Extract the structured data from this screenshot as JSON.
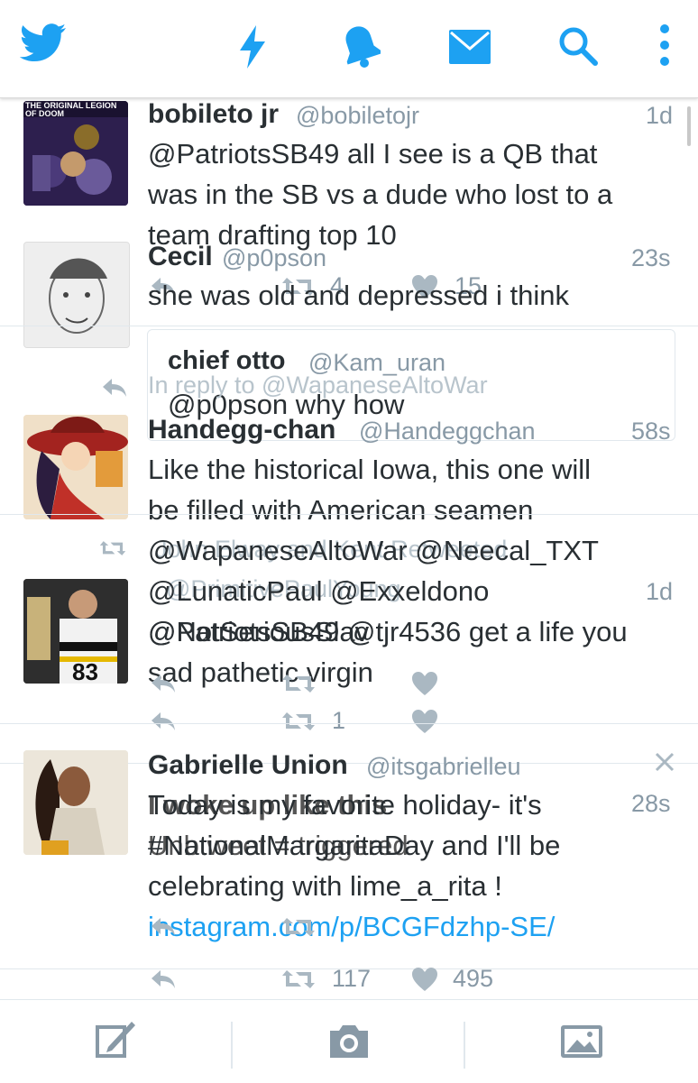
{
  "colors": {
    "accent": "#1da1f2",
    "icon_grey": "#8899a6",
    "text": "#292f33",
    "divider": "#e1e8ed"
  },
  "topbar": {
    "icons": [
      "twitter-bird-icon",
      "lightning-icon",
      "bell-icon",
      "envelope-icon",
      "search-icon",
      "more-vertical-icon"
    ]
  },
  "tweets": [
    {
      "name": "bobileto jr",
      "handle": "@bobiletojr",
      "time": "1d",
      "avatar_caption": "THE ORIGINAL LEGION OF DOOM",
      "body": [
        "@PatriotsSB49 all I see is a QB that",
        "was in the SB vs a dude who lost to a",
        "team drafting top 10"
      ],
      "retweets": "4",
      "likes": "15"
    },
    {
      "name": "Cecil",
      "handle": "@p0pson",
      "time": "23s",
      "body": [
        "she was old and depressed i think"
      ],
      "quote": {
        "name": "chief otto",
        "handle": "@Kam_uran",
        "body": "@p0pson why how"
      },
      "in_reply_to": "In reply to @WapaneseAltoWar"
    },
    {
      "name": "Handegg-chan",
      "handle": "@Handeggchan",
      "time": "58s",
      "body": [
        "Like the historical Iowa, this one will",
        "be filled with American seamen",
        "@WapaneseAltoWar @Neecal_TXT",
        "@LunaticPaul @Exxeldono",
        "@NotSeriousSlav"
      ],
      "ghost_retweeted": "John Elway and Kent Retweeted",
      "ghost_handle": "@PrimitivePaulYoung"
    },
    {
      "name": "",
      "handle": "",
      "time": "1d",
      "body": [
        "@PatriotsSB49 @tjr4536 get a life you",
        "sad pathetic virgin"
      ],
      "retweets": "1"
    },
    {
      "name": "Gabrielle Union",
      "handle": "@itsgabrielleu",
      "time": "28s",
      "body_overlap": [
        "Today is my favorite holiday- it's",
        "#NationalMargaritaDay and I'll be"
      ],
      "body_under": [
        "I woke up like this",
        "Unbtweet = triggered"
      ],
      "body": [
        "celebrating with lime_a_rita !"
      ],
      "link": "instagram.com/p/BCGFdzhp-SE/",
      "retweets": "117",
      "likes": "495"
    }
  ],
  "bottombar": {
    "icons": [
      "compose-tweet-icon",
      "camera-icon",
      "image-icon"
    ]
  }
}
